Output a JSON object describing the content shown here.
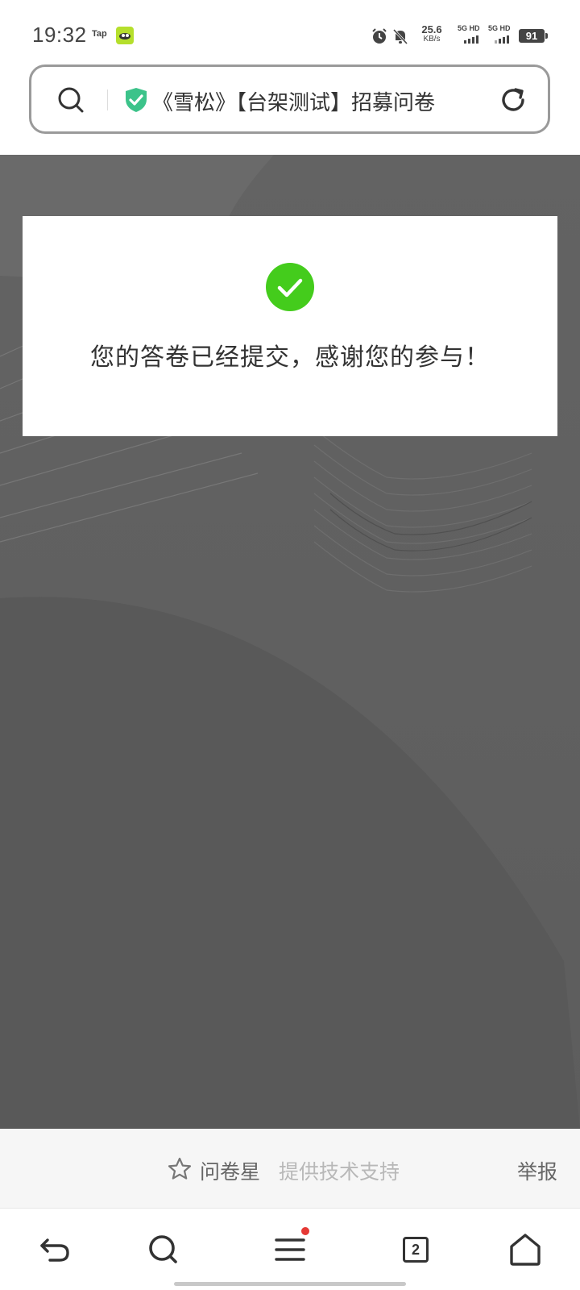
{
  "status_bar": {
    "time": "19:32",
    "tap_label": "Tap",
    "net_speed_value": "25.6",
    "net_speed_unit": "KB/s",
    "sim1_label": "5G HD",
    "sim2_label": "5G HD",
    "battery": "91",
    "icons": [
      "alarm-icon",
      "bell-off-icon",
      "signal-icon",
      "battery-icon"
    ]
  },
  "address_bar": {
    "title": "《雪松》【台架测试】招募问卷",
    "icons": [
      "search-icon",
      "shield-check-icon",
      "reload-icon"
    ],
    "secure_color": "#3cc38a"
  },
  "result": {
    "message": "您的答卷已经提交，感谢您的参与！",
    "success_color": "#44cc1c"
  },
  "footer": {
    "brand": "问卷星",
    "tagline": "提供技术支持",
    "report": "举报"
  },
  "bottom_nav": {
    "tab_count": "2",
    "items": [
      "back-icon",
      "search-icon",
      "menu-icon",
      "tabs-icon",
      "home-icon"
    ]
  }
}
